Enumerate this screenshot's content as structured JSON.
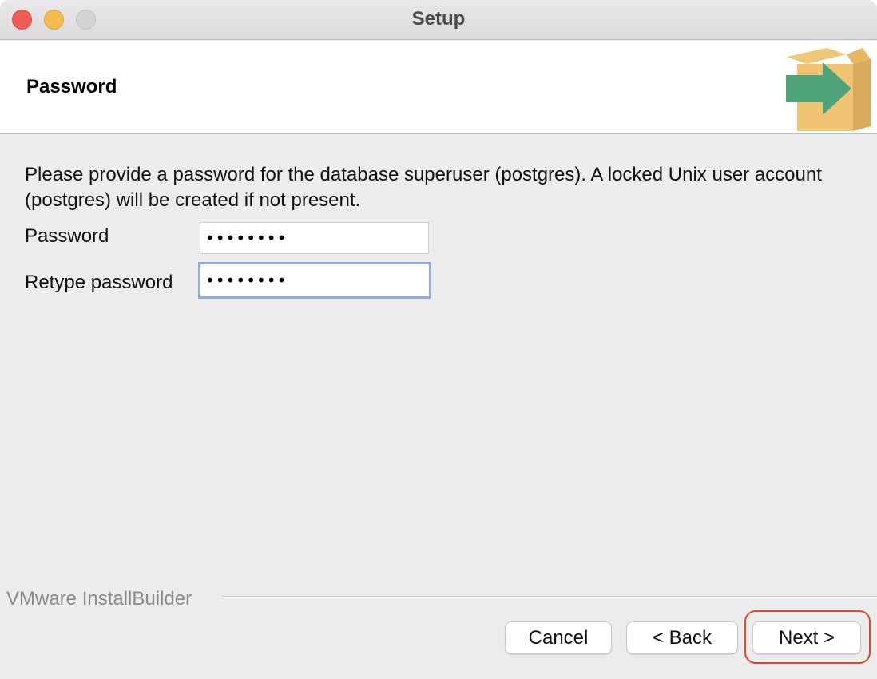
{
  "window": {
    "title": "Setup"
  },
  "header": {
    "page_title": "Password",
    "icon": "installer-box-arrow-icon"
  },
  "content": {
    "description": "Please provide a password for the database superuser (postgres). A locked Unix user account (postgres) will be created if not present.",
    "password_label": "Password",
    "password_value": "••••••••",
    "retype_label": "Retype password",
    "retype_value": "••••••••"
  },
  "footer": {
    "brand": "VMware InstallBuilder",
    "cancel_label": "Cancel",
    "back_label": "< Back",
    "next_label": "Next >"
  },
  "colors": {
    "accent_focus": "#90acdc",
    "annotation": "#e0462c",
    "close": "#ee5d55",
    "minimize": "#f5bd4f"
  }
}
